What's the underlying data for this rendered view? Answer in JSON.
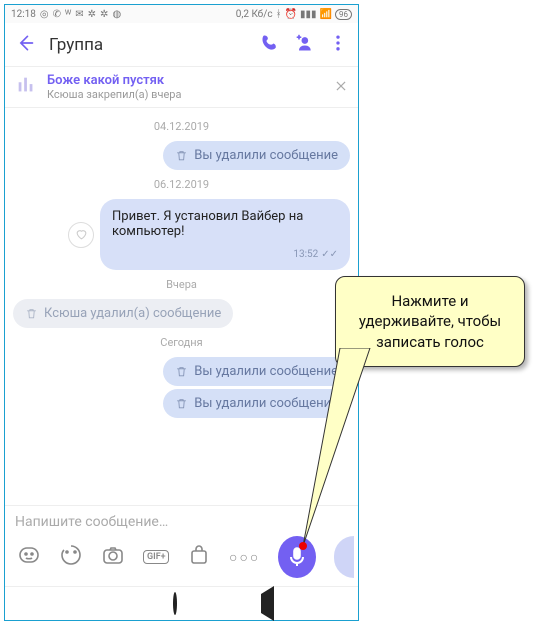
{
  "status": {
    "time": "12:18",
    "net_speed": "0,2 Кб/с",
    "battery": "96"
  },
  "header": {
    "title": "Группа"
  },
  "pinned": {
    "title": "Боже какой пустяк",
    "subtitle": "Ксюша закрепил(а) вчера"
  },
  "chat": {
    "dates": {
      "d1": "04.12.2019",
      "d2": "06.12.2019",
      "d3": "Вчера",
      "d4": "Сегодня"
    },
    "deleted_label": "Вы удалили сообщение",
    "other_deleted": "Ксюша удалил(а) сообщение",
    "msg1": {
      "text": "Привет. Я установил Вайбер на компьютер!",
      "time": "13:52"
    }
  },
  "composer": {
    "placeholder": "Напишите сообщение…",
    "gif_label": "GIF+",
    "more": "○○○"
  },
  "tooltip": {
    "text": "Нажмите и удерживайте, чтобы записать голос"
  }
}
